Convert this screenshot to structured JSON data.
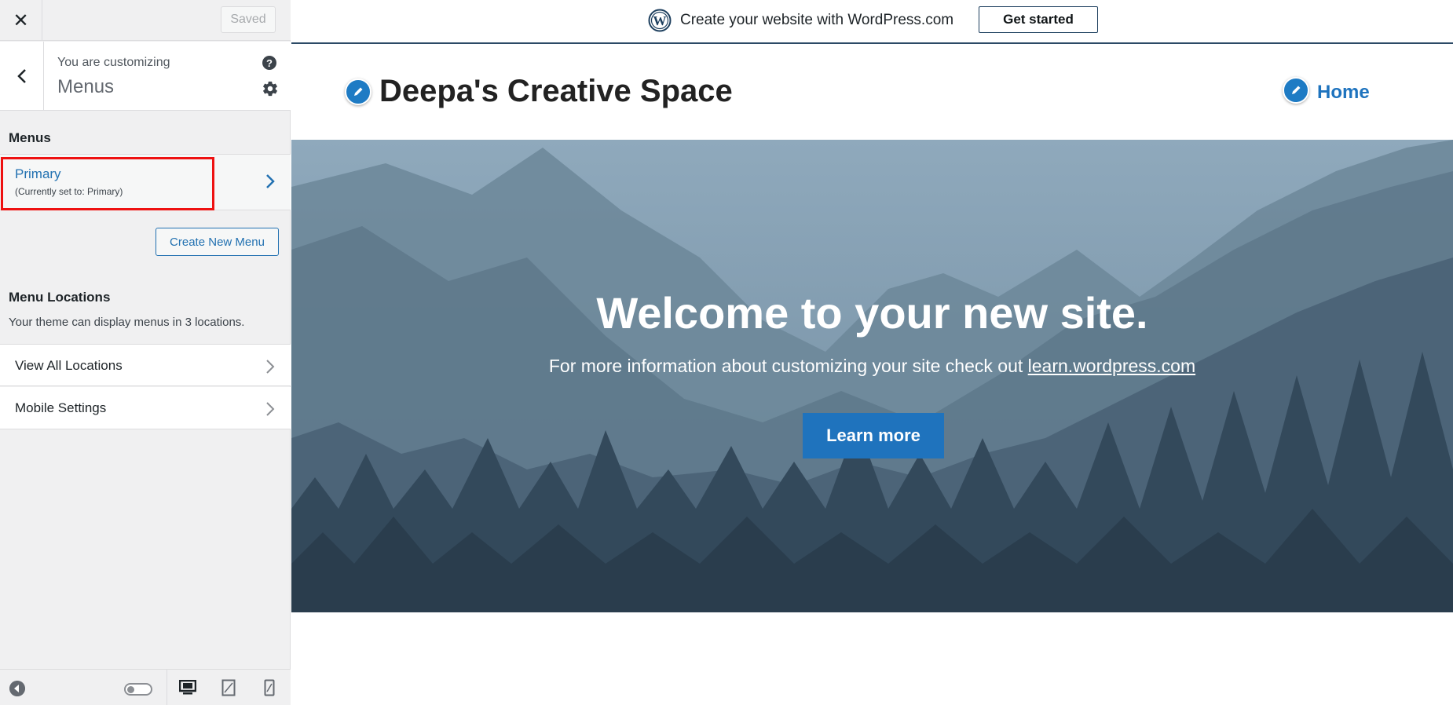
{
  "sidebar": {
    "close_icon": "close-icon",
    "saved_label": "Saved",
    "header": {
      "customizing_label": "You are customizing",
      "title": "Menus"
    },
    "menus_heading": "Menus",
    "primary_menu": {
      "title": "Primary",
      "subtitle": "(Currently set to: Primary)"
    },
    "create_menu_label": "Create New Menu",
    "locations": {
      "heading": "Menu Locations",
      "description": "Your theme can display menus in 3 locations."
    },
    "rows": [
      {
        "label": "View All Locations"
      },
      {
        "label": "Mobile Settings"
      }
    ],
    "footer": {
      "icons": [
        "collapse-icon",
        "toggle-icon",
        "desktop-icon",
        "tablet-icon",
        "mobile-icon"
      ]
    }
  },
  "preview": {
    "promo": {
      "text": "Create your website with WordPress.com",
      "button": "Get started"
    },
    "site": {
      "title": "Deepa's Creative Space",
      "nav_home": "Home"
    },
    "hero": {
      "title": "Welcome to your new site.",
      "subtitle_prefix": "For more information about customizing your site check out ",
      "subtitle_link": "learn.wordpress.com",
      "button": "Learn more"
    }
  },
  "colors": {
    "accent": "#2271b1",
    "highlight": "#ee1111",
    "button_blue": "#1f73bd",
    "sidebar_bg": "#f0f0f1"
  }
}
